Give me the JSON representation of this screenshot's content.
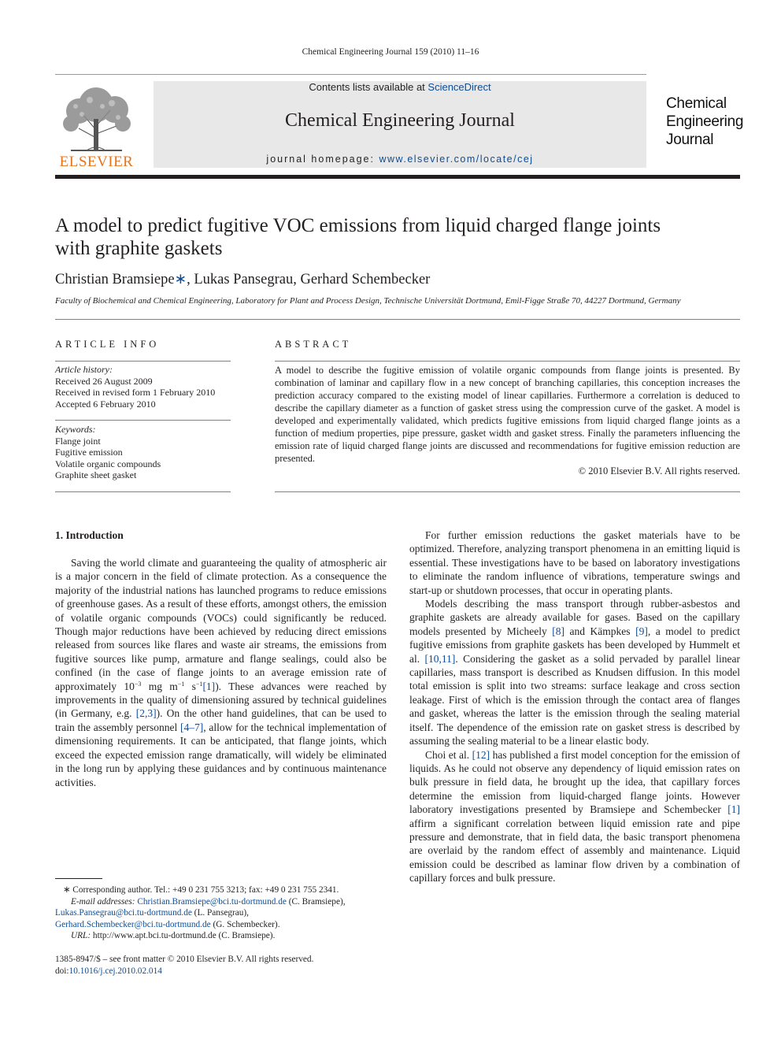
{
  "running_head": "Chemical Engineering Journal 159 (2010) 11–16",
  "masthead": {
    "contents_prefix": "Contents lists available at ",
    "contents_link": "ScienceDirect",
    "journal_name": "Chemical Engineering Journal",
    "homepage_prefix": "journal homepage: ",
    "homepage_link": "www.elsevier.com/locate/cej",
    "publisher_logo_text": "ELSEVIER",
    "cover_logo_lines": [
      "Chemical",
      "Engineering",
      "Journal"
    ],
    "colors": {
      "band": "#e8e8e8",
      "link": "#0a4d9a",
      "elsevier": "#e8741a"
    }
  },
  "article": {
    "title_line1": "A model to predict fugitive VOC emissions from liquid charged flange joints",
    "title_line2": "with graphite gaskets",
    "authors": [
      {
        "name": "Christian Bramsiepe",
        "marker": "∗",
        "sep": ", "
      },
      {
        "name": "Lukas Pansegrau",
        "marker": "",
        "sep": ", "
      },
      {
        "name": "Gerhard Schembecker",
        "marker": "",
        "sep": ""
      }
    ],
    "affiliation": "Faculty of Biochemical and Chemical Engineering, Laboratory for Plant and Process Design, Technische Universität Dortmund, Emil-Figge Straße 70, 44227 Dortmund, Germany"
  },
  "article_info": {
    "caption": "ARTICLE INFO",
    "history_label": "Article history:",
    "history": [
      "Received 26 August 2009",
      "Received in revised form 1 February 2010",
      "Accepted 6 February 2010"
    ],
    "keywords_label": "Keywords:",
    "keywords": [
      "Flange joint",
      "Fugitive emission",
      "Volatile organic compounds",
      "Graphite sheet gasket"
    ]
  },
  "abstract": {
    "caption": "ABSTRACT",
    "text": "A model to describe the fugitive emission of volatile organic compounds from flange joints is presented. By combination of laminar and capillary flow in a new concept of branching capillaries, this conception increases the prediction accuracy compared to the existing model of linear capillaries. Furthermore a correlation is deduced to describe the capillary diameter as a function of gasket stress using the compression curve of the gasket. A model is developed and experimentally validated, which predicts fugitive emissions from liquid charged flange joints as a function of medium properties, pipe pressure, gasket width and gasket stress. Finally the parameters influencing the emission rate of liquid charged flange joints are discussed and recommendations for fugitive emission reduction are presented.",
    "copyright": "© 2010 Elsevier B.V. All rights reserved."
  },
  "body": {
    "section_heading": "1.  Introduction",
    "left_paragraph": {
      "part1": "Saving the world climate and guaranteeing the quality of atmospheric air is a major concern in the field of climate protection. As a consequence the majority of the industrial nations has launched programs to reduce emissions of greenhouse gases. As a result of these efforts, amongst others, the emission of volatile organic compounds (VOCs) could significantly be reduced. Though major reductions have been achieved by reducing direct emissions released from sources like flares and waste air streams, the emissions from fugitive sources like pump, armature and flange sealings, could also be confined (in the case of flange joints to an average emission rate of approximately 10",
      "sup1": "−3",
      "part2": " mg m",
      "sup2": "−1",
      "part3": " s",
      "sup3": "−1",
      "ref1": "[1]",
      "part4": "). These advances were reached by improvements in the quality of dimensioning assured by technical guidelines (in Germany, e.g. ",
      "ref2": "[2,3]",
      "part5": "). On the other hand guidelines, that can be used to train the assembly personnel ",
      "ref3": "[4–7]",
      "part6": ", allow for the technical implementation of dimensioning requirements. It can be anticipated, that flange joints, which exceed the expected emission range dramatically, will widely be eliminated in the long run by applying these guidances and by continuous maintenance activities."
    },
    "right_paragraphs": {
      "p1": "For further emission reductions the gasket materials have to be optimized. Therefore, analyzing transport phenomena in an emitting liquid is essential. These investigations have to be based on laboratory investigations to eliminate the random influence of vibrations, temperature swings and start-up or shutdown processes, that occur in operating plants.",
      "p2_a": "Models describing the mass transport through rubber-asbestos and graphite gaskets are already available for gases. Based on the capillary models presented by Micheely ",
      "p2_ref1": "[8]",
      "p2_b": " and Kämpkes ",
      "p2_ref2": "[9]",
      "p2_c": ", a model to predict fugitive emissions from graphite gaskets has been developed by Hummelt et al. ",
      "p2_ref3": "[10,11]",
      "p2_d": ". Considering the gasket as a solid pervaded by parallel linear capillaries, mass transport is described as Knudsen diffusion. In this model total emission is split into two streams: surface leakage and cross section leakage. First of which is the emission through the contact area of flanges and gasket, whereas the latter is the emission through the sealing material itself. The dependence of the emission rate on gasket stress is described by assuming the sealing material to be a linear elastic body.",
      "p3_a": "Choi et al. ",
      "p3_ref1": "[12]",
      "p3_b": " has published a first model conception for the emission of liquids. As he could not observe any dependency of liquid emission rates on bulk pressure in field data, he brought up the idea, that capillary forces determine the emission from liquid-charged flange joints. However laboratory investigations presented by Bramsiepe and Schembecker ",
      "p3_ref2": "[1]",
      "p3_c": " affirm a significant correlation between liquid emission rate and pipe pressure and demonstrate, that in field data, the basic transport phenomena are overlaid by the random effect of assembly and maintenance. Liquid emission could be described as laminar flow driven by a combination of capillary forces and bulk pressure."
    }
  },
  "footnotes": {
    "corresponding": "∗  Corresponding author. Tel.: +49 0 231 755 3213; fax: +49 0 231 755 2341.",
    "email_label": "E-mail addresses:",
    "email1": "Christian.Bramsiepe@bci.tu-dortmund.de",
    "email1_owner": " (C. Bramsiepe),",
    "email2": "Lukas.Pansegrau@bci.tu-dortmund.de",
    "email2_owner": " (L. Pansegrau),",
    "email3": "Gerhard.Schembecker@bci.tu-dortmund.de",
    "email3_owner": " (G. Schembecker).",
    "url_label": "URL:",
    "url": " http://www.apt.bci.tu-dortmund.de (C. Bramsiepe).",
    "issn": "1385-8947/$ – see front matter © 2010 Elsevier B.V. All rights reserved.",
    "doi_label": "doi:",
    "doi": "10.1016/j.cej.2010.02.014"
  }
}
